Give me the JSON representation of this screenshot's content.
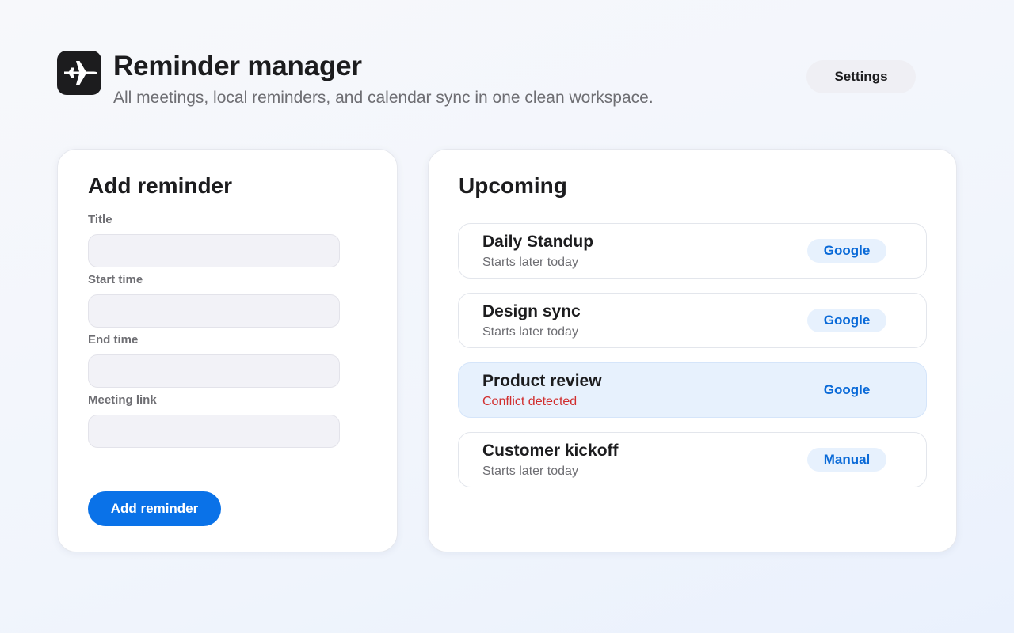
{
  "header": {
    "icon": "airplane-icon",
    "title": "Reminder manager",
    "subtitle": "All meetings, local reminders, and calendar sync in one clean workspace.",
    "settings_label": "Settings"
  },
  "add_form": {
    "title": "Add reminder",
    "fields": [
      {
        "label": "Title",
        "value": "",
        "placeholder": ""
      },
      {
        "label": "Start time",
        "value": "",
        "placeholder": ""
      },
      {
        "label": "End time",
        "value": "",
        "placeholder": ""
      },
      {
        "label": "Meeting link",
        "value": "",
        "placeholder": ""
      }
    ],
    "submit_label": "Add reminder"
  },
  "upcoming": {
    "title": "Upcoming",
    "items": [
      {
        "title": "Daily Standup",
        "status": "Starts later today",
        "source": "Google",
        "highlighted": false,
        "conflict": false
      },
      {
        "title": "Design sync",
        "status": "Starts later today",
        "source": "Google",
        "highlighted": false,
        "conflict": false
      },
      {
        "title": "Product review",
        "status": "Conflict detected",
        "source": "Google",
        "highlighted": true,
        "conflict": true
      },
      {
        "title": "Customer kickoff",
        "status": "Starts later today",
        "source": "Manual",
        "highlighted": false,
        "conflict": false
      }
    ]
  },
  "colors": {
    "accent": "#0a72e8",
    "conflict": "#d12e2e",
    "badge_bg": "#e7f1fd",
    "highlight_bg": "#e7f1fd"
  }
}
